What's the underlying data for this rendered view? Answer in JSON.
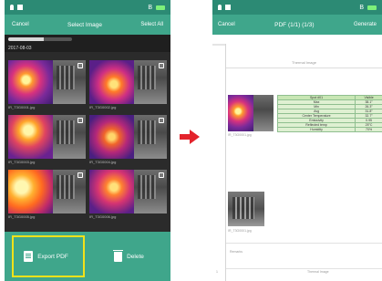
{
  "left": {
    "status": {
      "left_icons": [
        "location-icon",
        "sim-icon"
      ],
      "network": "B",
      "battery_color": "#7ef07a"
    },
    "appbar": {
      "cancel": "Cancel",
      "title": "Select Image",
      "select_all": "Select All"
    },
    "progress": {
      "fraction": 0.55
    },
    "date_label": "2017-08-03",
    "images": [
      {
        "caption": "IR_T3G0001.jpg"
      },
      {
        "caption": "IR_T3G0002.jpg"
      },
      {
        "caption": "IR_T3G0003.jpg"
      },
      {
        "caption": "IR_T3G0004.jpg"
      },
      {
        "caption": "IR_T3G0005.jpg"
      },
      {
        "caption": "IR_T3G0006.jpg"
      }
    ],
    "bottom": {
      "export_label": "Export PDF",
      "delete_label": "Delete"
    },
    "colors": {
      "bar": "#3fa68b",
      "status": "#2c8a74",
      "highlight": "#f2e21a"
    }
  },
  "arrow_color": "#e3232c",
  "right": {
    "status": {
      "network": "B",
      "battery_color": "#7ef07a"
    },
    "appbar": {
      "cancel": "Cancel",
      "title": "PDF (1/1) (1/3)",
      "generate": "Generate"
    },
    "page_header": "Thermal Image",
    "image1_caption": "IR_T3G0001.jpg",
    "table": {
      "rows": [
        [
          "Spot #01",
          "Visible"
        ],
        [
          "Max",
          "38.1°"
        ],
        [
          "Min",
          "26.3°"
        ],
        [
          "Avg",
          "31.8°"
        ],
        [
          "Center Temperature",
          "32.7°"
        ],
        [
          "Emissivity",
          "0.95"
        ],
        [
          "Reflected temp",
          "25°C"
        ],
        [
          "Humidity",
          "70%"
        ]
      ]
    },
    "image2_caption": "IR_T3G0001.jpg",
    "remark_label": "Remarks",
    "footer_left": "1",
    "footer_center": "Thermal Image"
  }
}
